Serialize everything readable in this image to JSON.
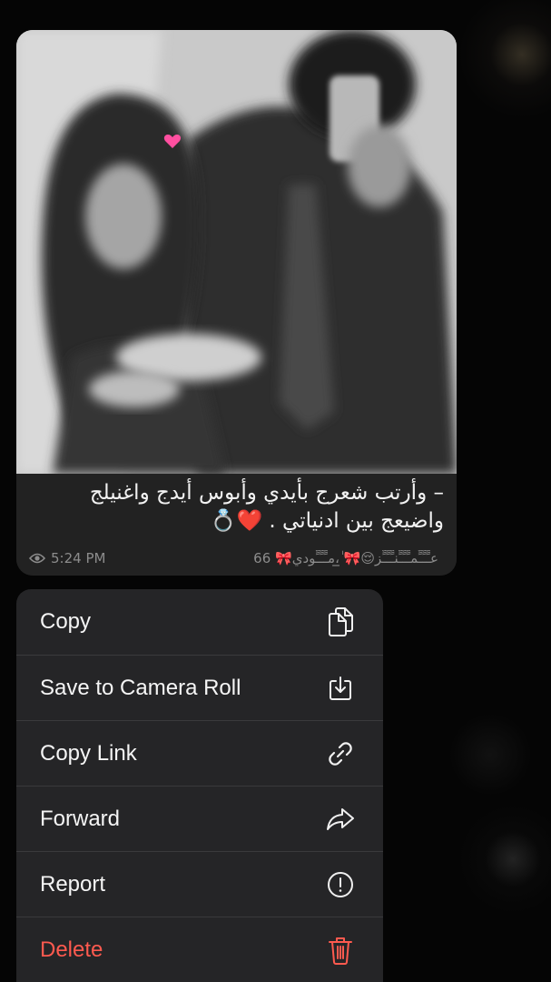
{
  "message": {
    "caption_lines": [
      "– وأرتب شعرج بأيدي وأبوس أيدج واغنيلج",
      "واضيعج بين ادنياتي . ❤️💍"
    ],
    "reactions": "66 🎀عـٍّـٍّـٍّمـٍّـٍّـٍّنـٍّـٍّـٍّز😌🎀 ٰٰٰٰٰٰٰٰٰٰٰٰٰٰٰ̲̲،مـٍّـٍّـٍّودي",
    "time": "5:24 PM",
    "view_icon": "eye-icon"
  },
  "menu": {
    "items": [
      {
        "label": "Copy",
        "icon": "copy-icon"
      },
      {
        "label": "Save to Camera Roll",
        "icon": "save-icon"
      },
      {
        "label": "Copy Link",
        "icon": "link-icon"
      },
      {
        "label": "Forward",
        "icon": "forward-icon"
      },
      {
        "label": "Report",
        "icon": "report-icon"
      },
      {
        "label": "Delete",
        "icon": "trash-icon"
      }
    ]
  },
  "colors": {
    "menu_bg": "#252527",
    "danger": "#ff5a4f",
    "bubble_bg": "#222222"
  }
}
